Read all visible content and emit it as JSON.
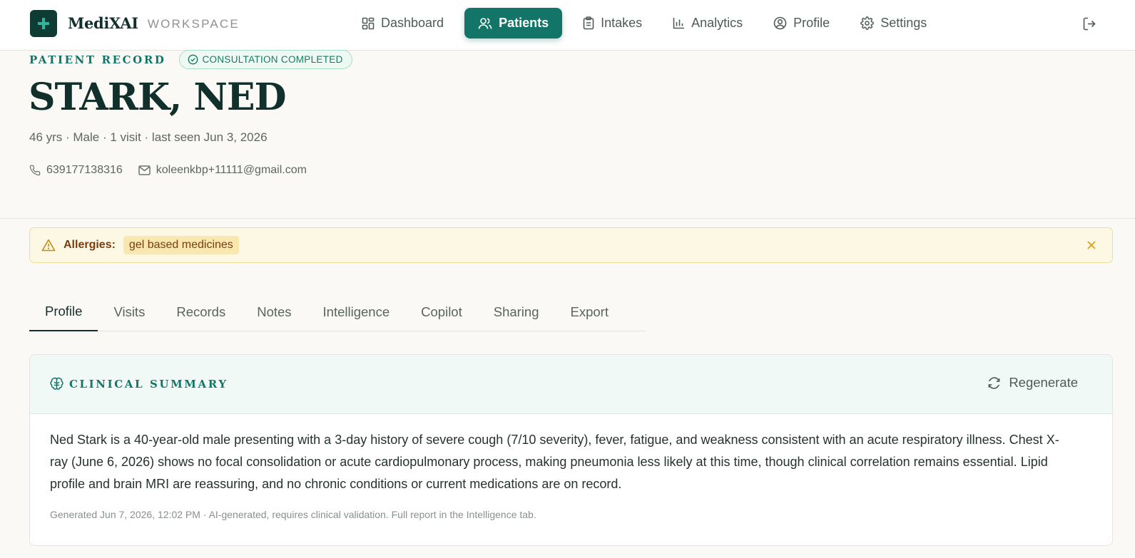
{
  "brand": {
    "name": "MediXAI",
    "subtitle": "WORKSPACE",
    "logo_icon": "plus-cross-icon"
  },
  "nav": {
    "items": [
      {
        "label": "Dashboard",
        "icon": "dashboard-icon",
        "active": false
      },
      {
        "label": "Patients",
        "icon": "users-icon",
        "active": true
      },
      {
        "label": "Intakes",
        "icon": "clipboard-icon",
        "active": false
      },
      {
        "label": "Analytics",
        "icon": "bar-chart-icon",
        "active": false
      },
      {
        "label": "Profile",
        "icon": "user-circle-icon",
        "active": false
      },
      {
        "label": "Settings",
        "icon": "gear-icon",
        "active": false
      }
    ],
    "logout_icon": "logout-icon"
  },
  "header": {
    "eyebrow": "PATIENT RECORD",
    "status": "CONSULTATION COMPLETED",
    "name": "STARK, NED",
    "demographics": "46 yrs · Male · 1 visit · last seen Jun 3, 2026",
    "phone": "639177138316",
    "email": "koleenkbp+11111@gmail.com"
  },
  "allergies": {
    "label": "Allergies:",
    "items": [
      "gel based medicines"
    ]
  },
  "tabs": [
    {
      "label": "Profile",
      "active": true
    },
    {
      "label": "Visits",
      "active": false
    },
    {
      "label": "Records",
      "active": false
    },
    {
      "label": "Notes",
      "active": false
    },
    {
      "label": "Intelligence",
      "active": false
    },
    {
      "label": "Copilot",
      "active": false
    },
    {
      "label": "Sharing",
      "active": false
    },
    {
      "label": "Export",
      "active": false
    }
  ],
  "summary": {
    "title": "CLINICAL SUMMARY",
    "regenerate_label": "Regenerate",
    "text": "Ned Stark is a 40-year-old male presenting with a 3-day history of severe cough (7/10 severity), fever, fatigue, and weakness consistent with an acute respiratory illness. Chest X-ray (June 6, 2026) shows no focal consolidation or acute cardiopulmonary process, making pneumonia less likely at this time, though clinical correlation remains essential. Lipid profile and brain MRI are reassuring, and no chronic conditions or current medications are on record.",
    "footer": "Generated Jun 7, 2026, 12:02 PM · AI-generated, requires clinical validation. Full report in the Intelligence tab."
  },
  "colors": {
    "accent": "#127568",
    "dark": "#12302b",
    "allergy_bg": "#fdf8e4",
    "allergy_text": "#7a3d10"
  }
}
